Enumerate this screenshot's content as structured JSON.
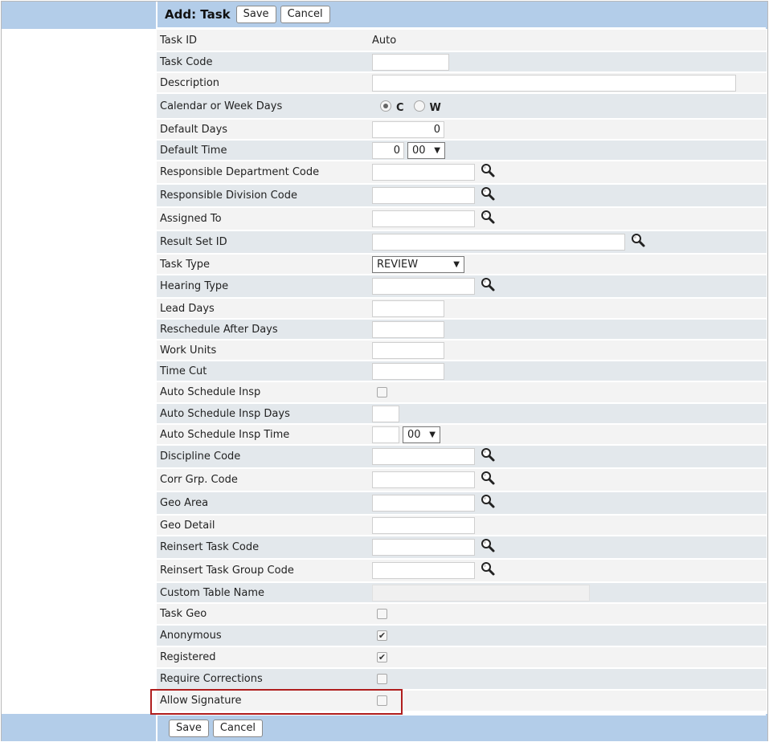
{
  "header": {
    "title": "Add: Task",
    "save_label": "Save",
    "cancel_label": "Cancel"
  },
  "footer": {
    "save_label": "Save",
    "cancel_label": "Cancel"
  },
  "fields": {
    "task_id": {
      "label": "Task ID",
      "value": "Auto"
    },
    "task_code": {
      "label": "Task Code",
      "value": ""
    },
    "description": {
      "label": "Description",
      "value": ""
    },
    "calendar_or_week_days": {
      "label": "Calendar or Week Days",
      "option_c": "C",
      "option_w": "W",
      "selected": "C"
    },
    "default_days": {
      "label": "Default Days",
      "value": "0"
    },
    "default_time": {
      "label": "Default Time",
      "hour": "0",
      "minute": "00"
    },
    "responsible_department_code": {
      "label": "Responsible Department Code",
      "value": ""
    },
    "responsible_division_code": {
      "label": "Responsible Division Code",
      "value": ""
    },
    "assigned_to": {
      "label": "Assigned To",
      "value": ""
    },
    "result_set_id": {
      "label": "Result Set ID",
      "value": ""
    },
    "task_type": {
      "label": "Task Type",
      "value": "REVIEW"
    },
    "hearing_type": {
      "label": "Hearing Type",
      "value": ""
    },
    "lead_days": {
      "label": "Lead Days",
      "value": ""
    },
    "reschedule_after_days": {
      "label": "Reschedule After Days",
      "value": ""
    },
    "work_units": {
      "label": "Work Units",
      "value": ""
    },
    "time_cut": {
      "label": "Time Cut",
      "value": ""
    },
    "auto_schedule_insp": {
      "label": "Auto Schedule Insp",
      "checked": false
    },
    "auto_schedule_insp_days": {
      "label": "Auto Schedule Insp Days",
      "value": ""
    },
    "auto_schedule_insp_time": {
      "label": "Auto Schedule Insp Time",
      "hour": "",
      "minute": "00"
    },
    "discipline_code": {
      "label": "Discipline Code",
      "value": ""
    },
    "corr_grp_code": {
      "label": "Corr Grp. Code",
      "value": ""
    },
    "geo_area": {
      "label": "Geo Area",
      "value": ""
    },
    "geo_detail": {
      "label": "Geo Detail",
      "value": ""
    },
    "reinsert_task_code": {
      "label": "Reinsert Task Code",
      "value": ""
    },
    "reinsert_task_group_code": {
      "label": "Reinsert Task Group Code",
      "value": ""
    },
    "custom_table_name": {
      "label": "Custom Table Name",
      "value": ""
    },
    "task_geo": {
      "label": "Task Geo",
      "checked": false
    },
    "anonymous": {
      "label": "Anonymous",
      "checked": true
    },
    "registered": {
      "label": "Registered",
      "checked": true
    },
    "require_corrections": {
      "label": "Require Corrections",
      "checked": false
    },
    "allow_signature": {
      "label": "Allow Signature",
      "checked": false
    }
  },
  "colors": {
    "header_band": "#b3cde9",
    "row_light": "#f3f3f3",
    "row_dark": "#e3e8ec",
    "highlight_border": "#b01e1e"
  },
  "icons": {
    "lookup": "magnifier-icon",
    "dropdown": "triangle-down",
    "checkmark": "checkmark"
  }
}
